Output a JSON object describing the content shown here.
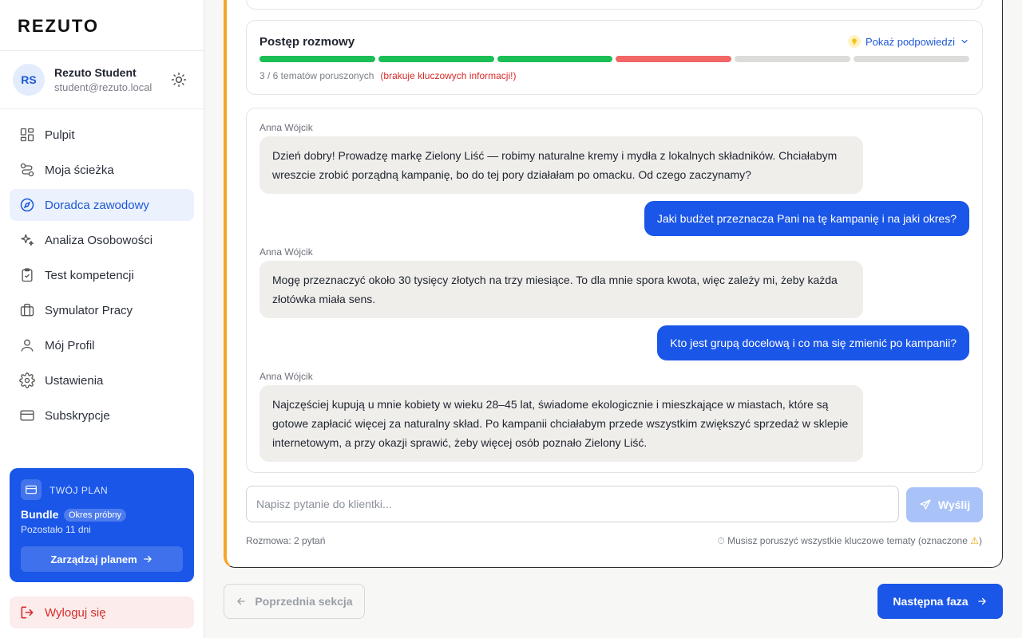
{
  "app": {
    "logo": "REZUTO"
  },
  "user": {
    "initials": "RS",
    "name": "Rezuto Student",
    "email": "student@rezuto.local"
  },
  "sidebar": {
    "items": [
      {
        "label": "Pulpit",
        "icon": "dashboard-icon",
        "active": false
      },
      {
        "label": "Moja ścieżka",
        "icon": "path-icon",
        "active": false
      },
      {
        "label": "Doradca zawodowy",
        "icon": "compass-icon",
        "active": true
      },
      {
        "label": "Analiza Osobowości",
        "icon": "sparkles-icon",
        "active": false
      },
      {
        "label": "Test kompetencji",
        "icon": "clipboard-icon",
        "active": false
      },
      {
        "label": "Symulator Pracy",
        "icon": "briefcase-icon",
        "active": false
      },
      {
        "label": "Mój Profil",
        "icon": "user-icon",
        "active": false
      },
      {
        "label": "Ustawienia",
        "icon": "gear-icon",
        "active": false
      },
      {
        "label": "Subskrypcje",
        "icon": "card-icon",
        "active": false
      }
    ],
    "logout_label": "Wyloguj się"
  },
  "plan": {
    "label": "TWÓJ PLAN",
    "name": "Bundle",
    "badge": "Okres próbny",
    "remaining": "Pozostało 11 dni",
    "manage_label": "Zarządzaj planem"
  },
  "progress": {
    "title": "Postęp rozmowy",
    "hints_label": "Pokaż podpowiedzi",
    "stat": "3 / 6 tematów poruszonych",
    "warning": "(brakuje kluczowych informacji!)",
    "segments": [
      "complete",
      "complete",
      "complete",
      "missing",
      "empty",
      "empty"
    ],
    "colors": {
      "complete": "#1bbf55",
      "missing": "#f26666",
      "empty": "#dcdcda"
    }
  },
  "chat": {
    "messages": [
      {
        "from": "client",
        "sender": "Anna Wójcik",
        "text": "Dzień dobry! Prowadzę markę Zielony Liść — robimy naturalne kremy i mydła z lokalnych składników. Chciałabym wreszcie zrobić porządną kampanię, bo do tej pory działałam po omacku. Od czego zaczynamy?"
      },
      {
        "from": "user",
        "text": "Jaki budżet przeznacza Pani na tę kampanię i na jaki okres?"
      },
      {
        "from": "client",
        "sender": "Anna Wójcik",
        "text": "Mogę przeznaczyć około 30 tysięcy złotych na trzy miesiące. To dla mnie spora kwota, więc zależy mi, żeby każda złotówka miała sens."
      },
      {
        "from": "user",
        "text": "Kto jest grupą docelową i co ma się zmienić po kampanii?"
      },
      {
        "from": "client",
        "sender": "Anna Wójcik",
        "text": "Najczęściej kupują u mnie kobiety w wieku 28–45 lat, świadome ekologicznie i mieszkające w miastach, które są gotowe zapłacić więcej za naturalny skład. Po kampanii chciałabym przede wszystkim zwiększyć sprzedaż w sklepie internetowym, a przy okazji sprawić, żeby więcej osób poznało Zielony Liść."
      }
    ],
    "input_placeholder": "Napisz pytanie do klientki...",
    "input_value": "",
    "send_label": "Wyślij",
    "counter": "Rozmowa: 2 pytań",
    "requirement": "Musisz poruszyć wszystkie kluczowe tematy (oznaczone",
    "requirement_end": ")"
  },
  "navigation": {
    "prev_label": "Poprzednia sekcja",
    "next_label": "Następna faza"
  }
}
